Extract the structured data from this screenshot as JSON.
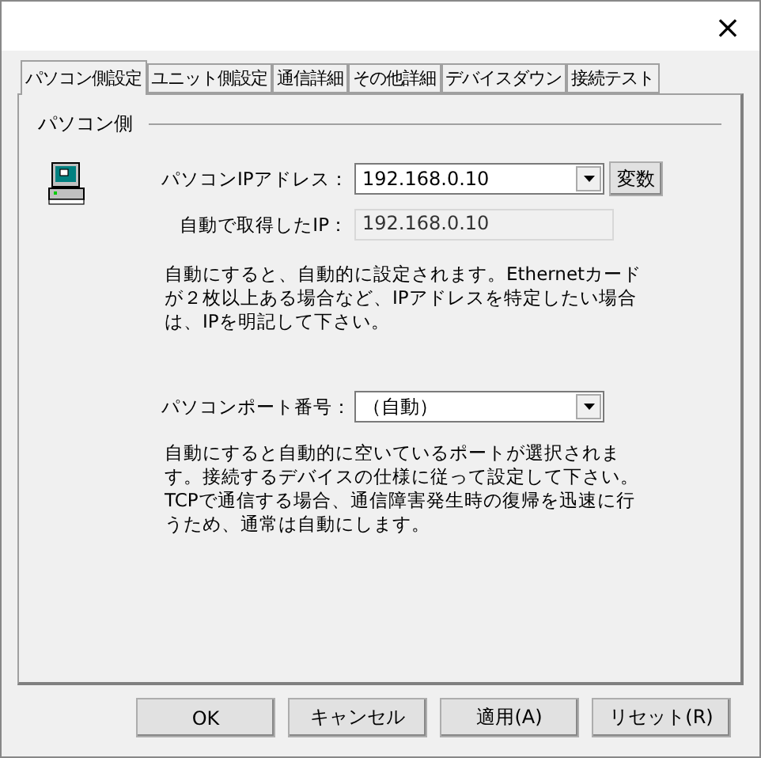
{
  "window": {
    "close": "×"
  },
  "tabs": [
    {
      "label": "パソコン側設定",
      "selected": true
    },
    {
      "label": "ユニット側設定",
      "selected": false
    },
    {
      "label": "通信詳細",
      "selected": false
    },
    {
      "label": "その他詳細",
      "selected": false
    },
    {
      "label": "デバイスダウン",
      "selected": false
    },
    {
      "label": "接続テスト",
      "selected": false
    }
  ],
  "group": {
    "title": "パソコン側",
    "ip": {
      "label": "パソコンIPアドレス：",
      "value": "192.168.0.10",
      "button": "変数"
    },
    "auto_ip": {
      "label": "自動で取得したIP：",
      "value": "192.168.0.10"
    },
    "ip_note": "自動にすると、自動的に設定されます。Ethernetカードが２枚以上ある場合など、IPアドレスを特定したい場合は、IPを明記して下さい。",
    "port": {
      "label": "パソコンポート番号：",
      "value": "（自動）"
    },
    "port_note": "自動にすると自動的に空いているポートが選択されます。接続するデバイスの仕様に従って設定して下さい。TCPで通信する場合、通信障害発生時の復帰を迅速に行うため、通常は自動にします。"
  },
  "buttons": [
    "OK",
    "キャンセル",
    "適用(A)",
    "リセット(R)"
  ]
}
